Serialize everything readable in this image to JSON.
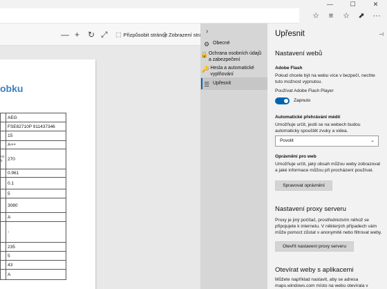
{
  "browser": {
    "window_buttons": [
      "—",
      "☐",
      "✕"
    ],
    "tool_icons": [
      "☆",
      "≡",
      "☆",
      "⬈",
      "···"
    ]
  },
  "pdf_toolbar": {
    "zoom_out": "—",
    "zoom_in": "+",
    "rotate": "↻",
    "fullscreen": "⤢",
    "fit_page_label": "Přizpůsobit stránce",
    "page_view_label": "Zobrazení stránky"
  },
  "document": {
    "heading": "obku",
    "rows": [
      {
        "label": "",
        "value": "AEG"
      },
      {
        "label": "",
        "value": "FSE82710P 911437346"
      },
      {
        "label": "",
        "value": "15"
      },
      {
        "label": "",
        "value": "A++"
      },
      {
        "label": "no\nk",
        "value": "270"
      },
      {
        "label": "",
        "value": "0.961"
      },
      {
        "label": "",
        "value": "0.1"
      },
      {
        "label": "",
        "value": "5"
      },
      {
        "label": "",
        "value": "3080"
      },
      {
        "label": "",
        "value": "A"
      },
      {
        "label": "",
        "value": "-"
      },
      {
        "label": "",
        "value": "235"
      },
      {
        "label": "",
        "value": "5"
      },
      {
        "label": "",
        "value": "43"
      },
      {
        "label": "",
        "value": "A"
      }
    ]
  },
  "hub_nav": {
    "back": "›",
    "items": [
      {
        "icon": "⚙",
        "label": "Obecné"
      },
      {
        "icon": "🔒",
        "label": "Ochrana osobních údajů a zabezpečení"
      },
      {
        "icon": "🔑",
        "label": "Hesla a automatické vyplňování"
      },
      {
        "icon": "☰",
        "label": "Upřesnit"
      }
    ]
  },
  "panel": {
    "title": "Upřesnit",
    "pin": "⊣",
    "web_settings": {
      "title": "Nastavení webů",
      "flash": {
        "title": "Adobe Flash",
        "desc": "Pokud chcete být na webu více v bezpečí, nechte tuto možnost vypnutou.",
        "toggle_caption": "Používat Adobe Flash Player",
        "toggle_state": "Zapnuto"
      },
      "autoplay": {
        "title": "Automatické přehrávání médií",
        "desc": "Umožňuje určit, jestli se na webech budou automaticky spouštět zvuky a videa.",
        "selected": "Povolit"
      },
      "permissions": {
        "title": "Oprávnění pro web",
        "desc": "Umožňuje určit, jaký obsah můžou weby zobrazovat a jaké informace můžou při procházení používat.",
        "button": "Spravovat oprávnění"
      }
    },
    "proxy": {
      "title": "Nastavení proxy serveru",
      "desc": "Proxy je jiný počítač, prostřednictvím něhož se připojujete k internetu. V některých případech vám může pomoct zůstat v anonymitě nebo filtrovat weby.",
      "button": "Otevřít nastavení proxy serveru"
    },
    "apps": {
      "title": "Otevírat weby s aplikacemi",
      "desc": "Můžete například nastavit, aby se adresa maps.windows.com místo na webu otevírala v"
    }
  }
}
